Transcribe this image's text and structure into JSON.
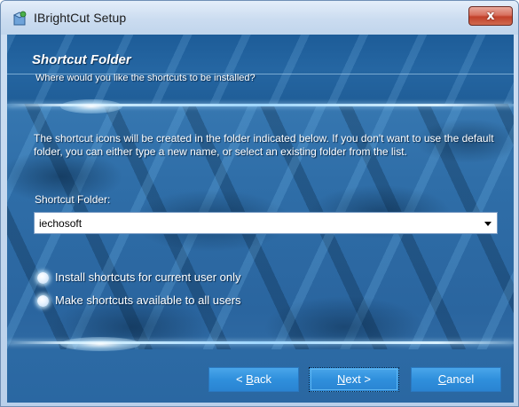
{
  "window": {
    "title": "IBrightCut Setup",
    "close_label": "x"
  },
  "banner": {
    "title": "Shortcut Folder",
    "subtitle": "Where would you like the shortcuts to be installed?"
  },
  "body": {
    "description": "The shortcut icons will be created in the folder indicated below. If you don't want to use the default folder, you can either type a new name, or select an existing folder from the list.",
    "folder_label": "Shortcut Folder:",
    "folder_value": "iechosoft"
  },
  "options": {
    "current_user": "Install shortcuts for current user only",
    "all_users": "Make shortcuts available to all users"
  },
  "buttons": {
    "back_prefix": "< ",
    "back_accel": "B",
    "back_rest": "ack",
    "next_accel": "N",
    "next_rest": "ext >",
    "cancel_accel": "C",
    "cancel_rest": "ancel"
  },
  "colors": {
    "accent": "#2f8fdc",
    "banner": "#1d5c98",
    "close": "#c2402a"
  }
}
